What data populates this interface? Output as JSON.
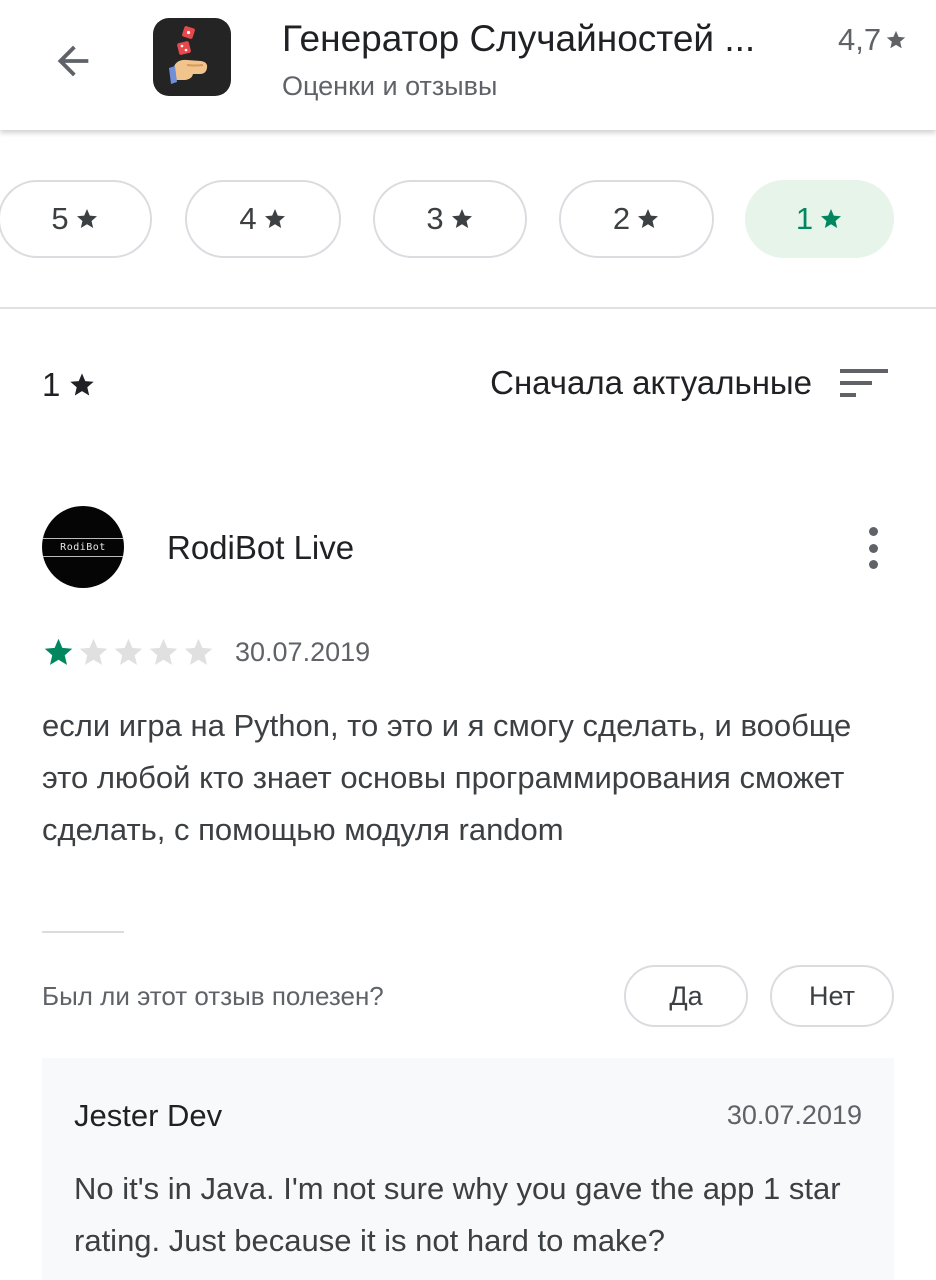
{
  "header": {
    "app_title": "Генератор Случайностей ...",
    "app_rating": "4,7",
    "subtitle": "Оценки и отзывы",
    "icon": "dice-hand-icon"
  },
  "rating_filters": [
    {
      "label": "5",
      "active": false
    },
    {
      "label": "4",
      "active": false
    },
    {
      "label": "3",
      "active": false
    },
    {
      "label": "2",
      "active": false
    },
    {
      "label": "1",
      "active": true
    }
  ],
  "filter_bar": {
    "current_filter": "1",
    "sort_label": "Сначала актуальные",
    "sort_icon": "sort-icon"
  },
  "review": {
    "author": "RodiBot Live",
    "avatar_text": "RodiBot",
    "rating": 1,
    "max_rating": 5,
    "date": "30.07.2019",
    "text": "если игра на Python, то это и я смогу сделать, и вообще это любой кто знает основы программирования сможет сделать, с помощью модуля random",
    "helpful_question": "Был ли этот отзыв полезен?",
    "yes_label": "Да",
    "no_label": "Нет"
  },
  "developer_reply": {
    "author": "Jester Dev",
    "date": "30.07.2019",
    "text": "No it's in Java. I'm not sure why you gave the app 1 star rating. Just because it is not hard to make?"
  },
  "colors": {
    "accent_green": "#01875f",
    "chip_active_bg": "#e6f4ea",
    "star_empty": "#e0e0e0"
  }
}
